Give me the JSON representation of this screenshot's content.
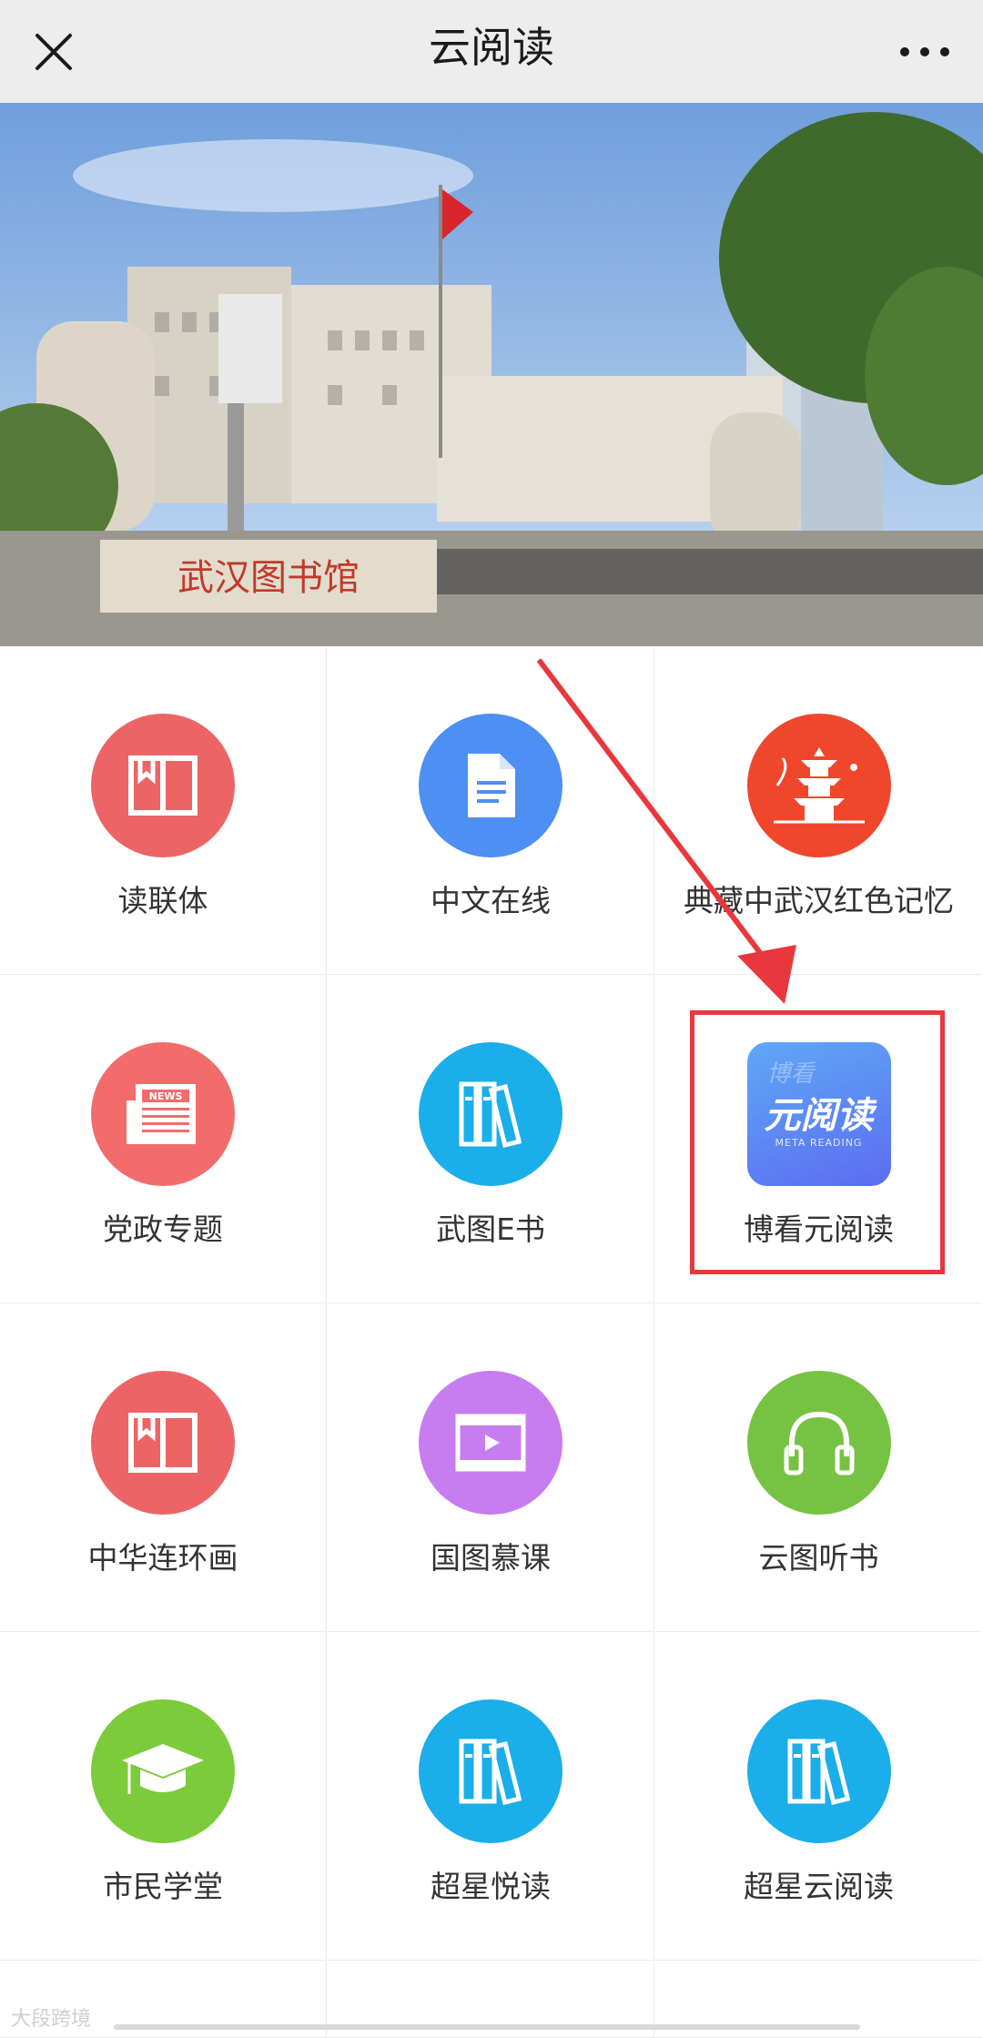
{
  "header": {
    "title": "云阅读"
  },
  "tiles": [
    {
      "label": "读联体",
      "icon": "book-icon",
      "color": "#ec6465"
    },
    {
      "label": "中文在线",
      "icon": "document-icon",
      "color": "#4d8ff2"
    },
    {
      "label": "典藏中武汉红色记忆",
      "icon": "yellow-crane-tower-icon",
      "color": "#f0462c"
    },
    {
      "label": "党政专题",
      "icon": "newspaper-icon",
      "color": "#f26c6c"
    },
    {
      "label": "武图E书",
      "icon": "bookshelf-icon",
      "color": "#1aaeea"
    },
    {
      "label": "博看元阅读",
      "icon": "meta-reading-logo",
      "color": "#5b8cf5",
      "logo_text": "元阅读",
      "logo_sub": "META READING",
      "logo_top": "博看"
    },
    {
      "label": "中华连环画",
      "icon": "book-icon",
      "color": "#ec6465"
    },
    {
      "label": "国图慕课",
      "icon": "video-icon",
      "color": "#c77cf0"
    },
    {
      "label": "云图听书",
      "icon": "headphones-icon",
      "color": "#76c243"
    },
    {
      "label": "市民学堂",
      "icon": "graduation-cap-icon",
      "color": "#7ccb3a"
    },
    {
      "label": "超星悦读",
      "icon": "bookshelf-icon",
      "color": "#1aaeea"
    },
    {
      "label": "超星云阅读",
      "icon": "bookshelf-icon",
      "color": "#1aaeea"
    }
  ],
  "banner": {
    "sign": "武汉图书馆"
  },
  "watermark": "大段跨境",
  "colors": {
    "highlight": "#e8383d",
    "topbar": "#ededed"
  }
}
